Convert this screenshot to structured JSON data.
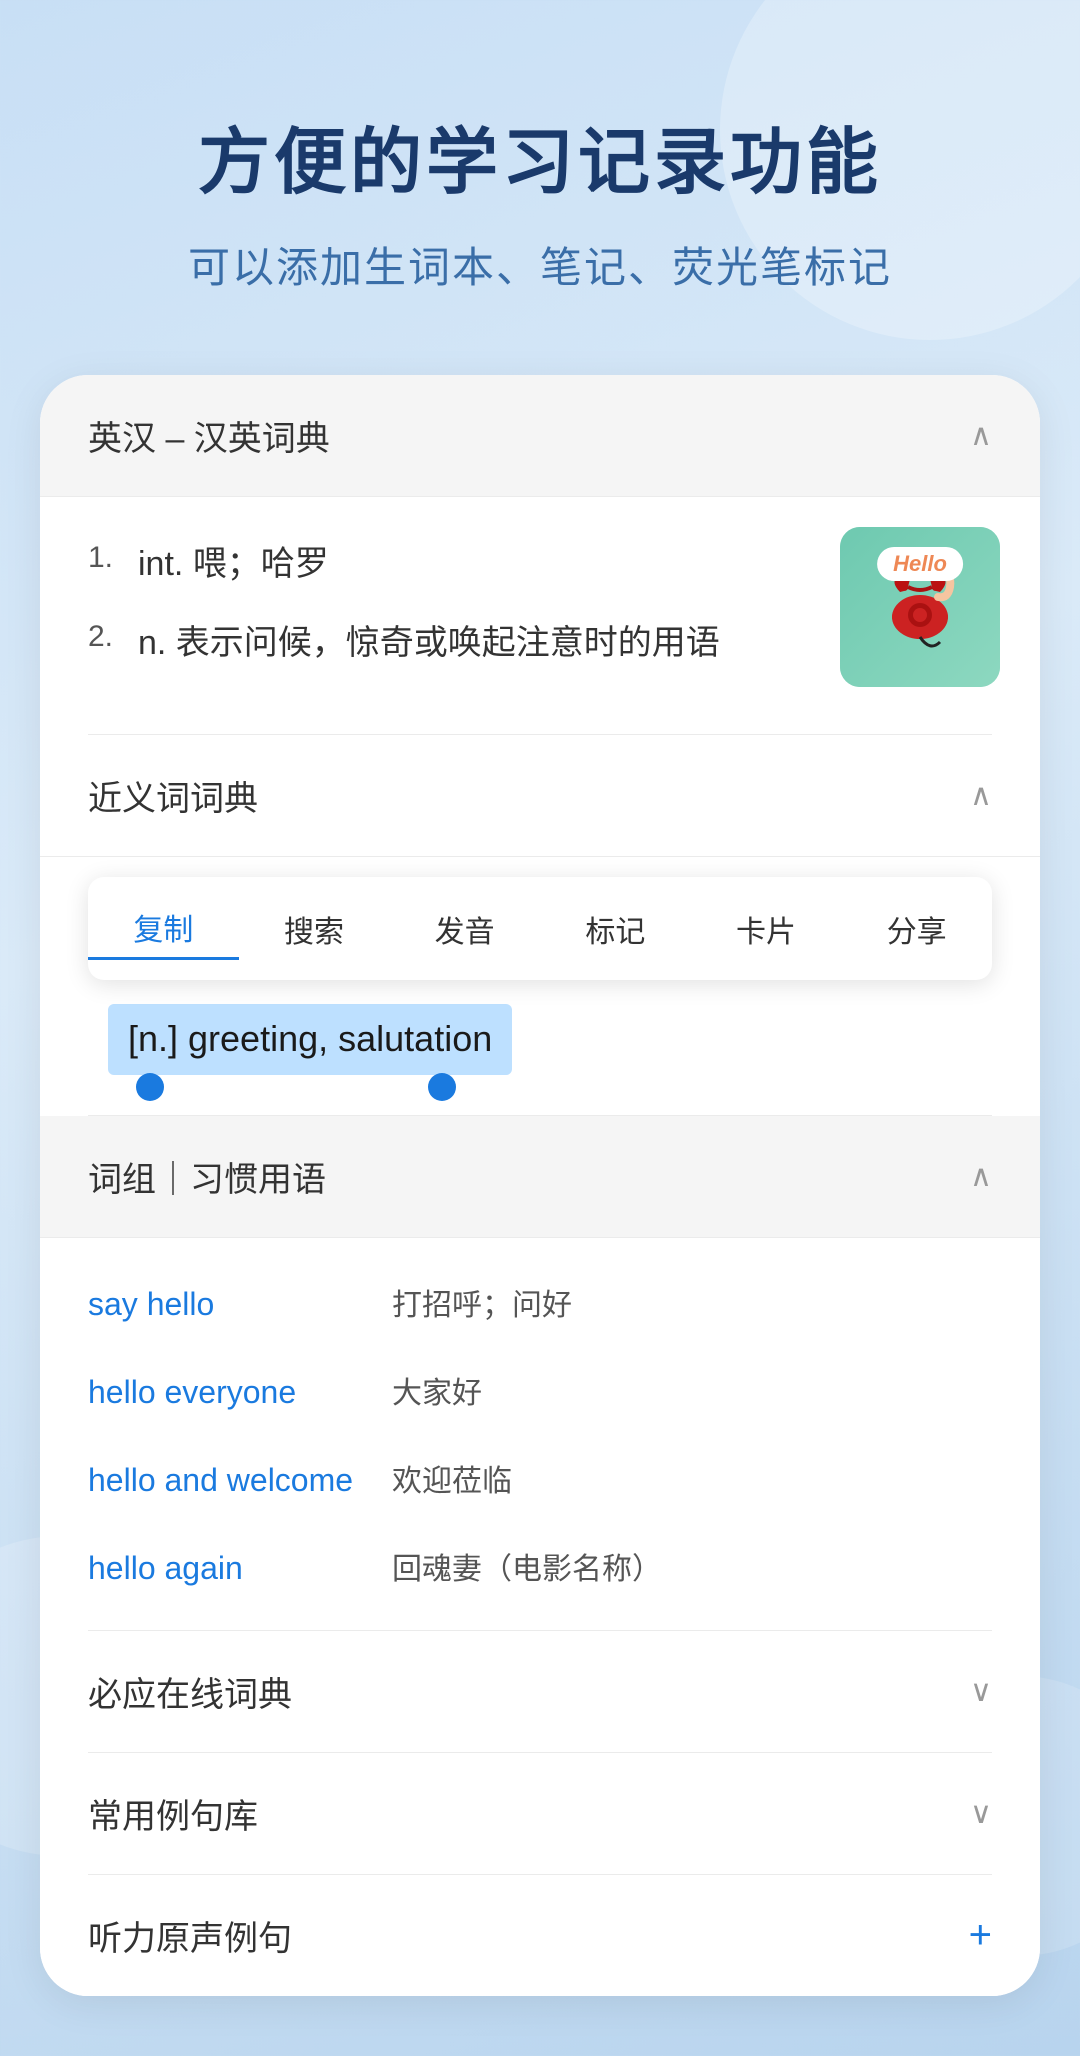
{
  "header": {
    "main_title": "方便的学习记录功能",
    "sub_title": "可以添加生词本、笔记、荧光笔标记"
  },
  "sections": {
    "english_chinese_dict": {
      "title": "英汉 – 汉英词典",
      "chevron": "∧",
      "definitions": [
        {
          "number": "1.",
          "text": "int. 喂；哈罗"
        },
        {
          "number": "2.",
          "text": "n. 表示问候，惊奇或唤起注意时的用语"
        }
      ],
      "hello_badge": "Hello"
    },
    "synonyms": {
      "title": "近义词词典",
      "chevron": "∧",
      "context_menu": {
        "items": [
          "复制",
          "搜索",
          "发音",
          "标记",
          "卡片",
          "分享"
        ]
      },
      "selected_text": "[n.] greeting, salutation"
    },
    "phrases": {
      "title": "词组｜习惯用语",
      "chevron": "∧",
      "items": [
        {
          "en": "say hello",
          "zh": "打招呼；问好"
        },
        {
          "en": "hello everyone",
          "zh": "大家好"
        },
        {
          "en": "hello and welcome",
          "zh": "欢迎莅临"
        },
        {
          "en": "hello again",
          "zh": "回魂妻（电影名称）"
        }
      ]
    },
    "biyingzaixian": {
      "title": "必应在线词典",
      "chevron": "∨"
    },
    "changyongliju": {
      "title": "常用例句库",
      "chevron": "∨"
    },
    "tingli": {
      "title": "听力原声例句",
      "plus": "+"
    }
  }
}
